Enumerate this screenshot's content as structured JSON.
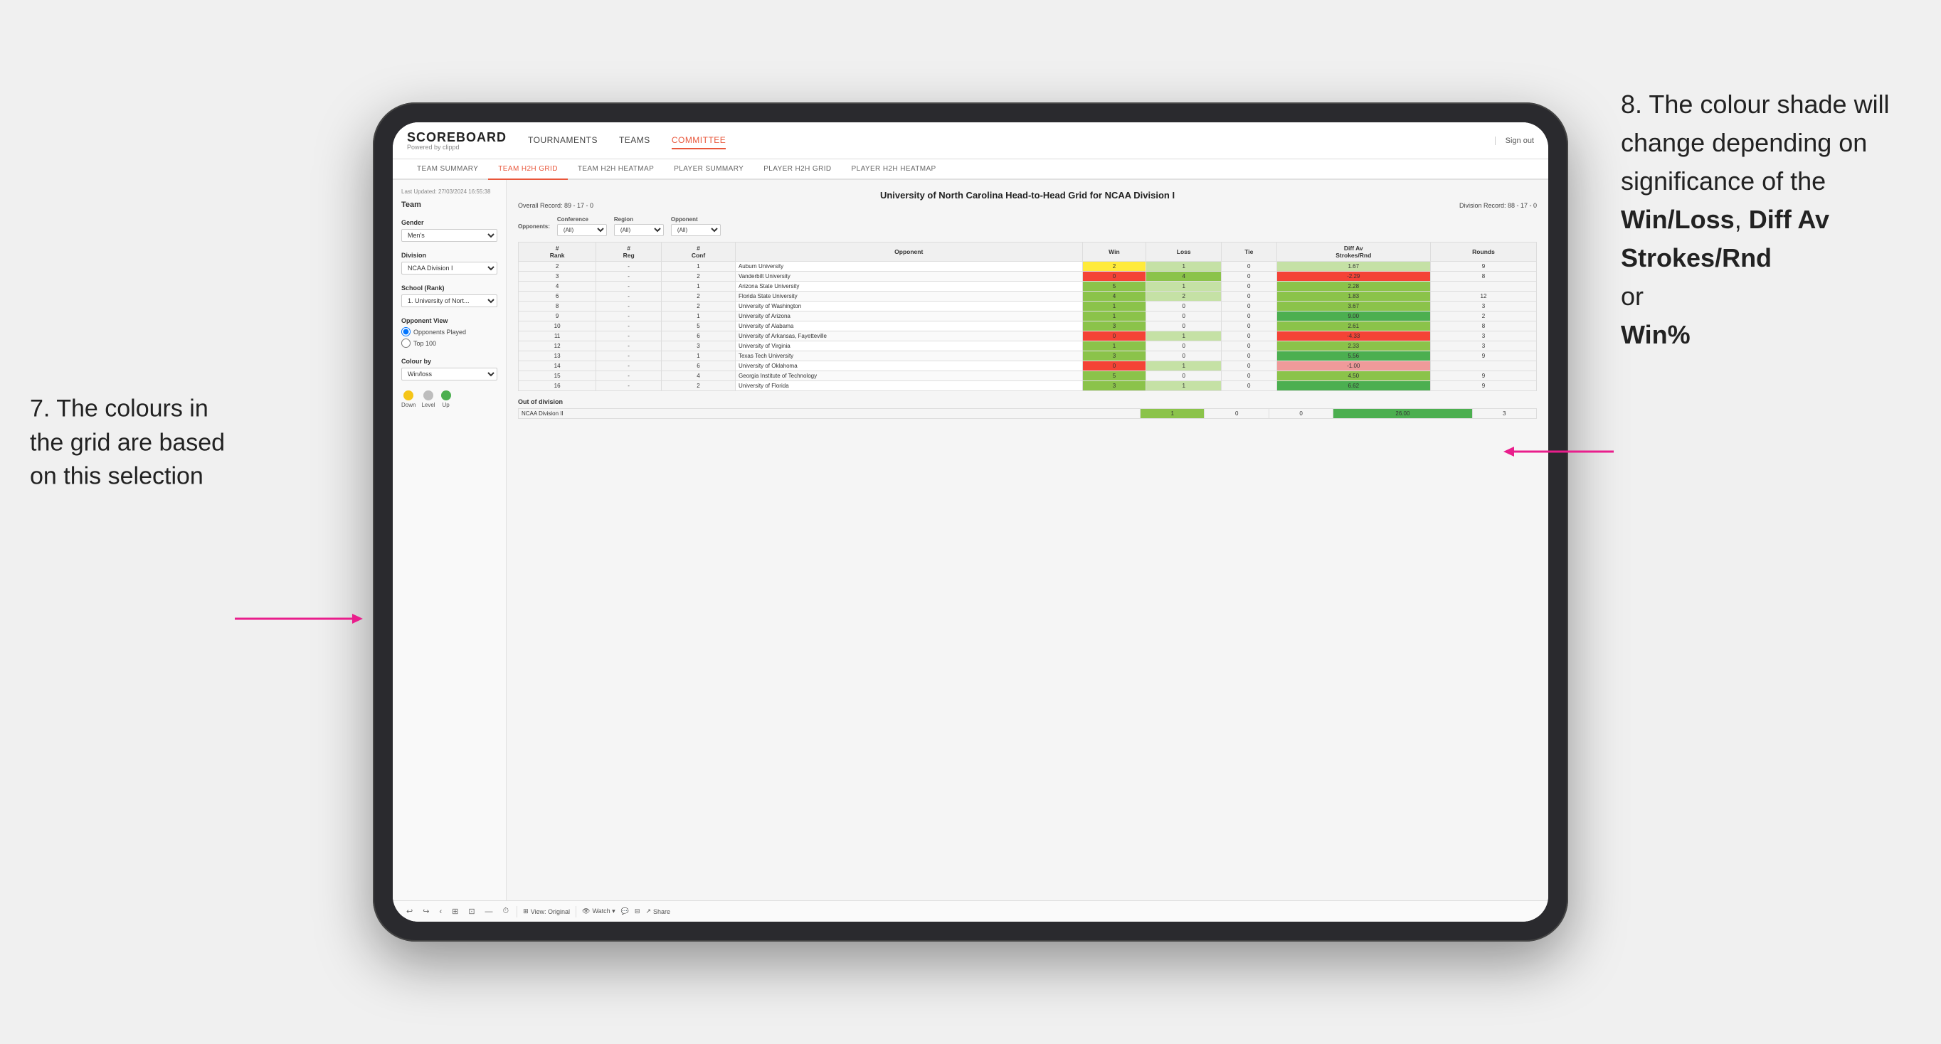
{
  "annotations": {
    "left_number": "7.",
    "left_text": "The colours in the grid are based on this selection",
    "right_number": "8.",
    "right_text": "The colour shade will change depending on significance of the",
    "right_bold1": "Win/Loss",
    "right_sep1": ", ",
    "right_bold2": "Diff Av Strokes/Rnd",
    "right_sep2": " or",
    "right_bold3": "Win%"
  },
  "app": {
    "logo": "SCOREBOARD",
    "logo_sub": "Powered by clippd",
    "sign_out": "Sign out"
  },
  "nav": {
    "items": [
      "TOURNAMENTS",
      "TEAMS",
      "COMMITTEE"
    ]
  },
  "sub_nav": {
    "items": [
      "TEAM SUMMARY",
      "TEAM H2H GRID",
      "TEAM H2H HEATMAP",
      "PLAYER SUMMARY",
      "PLAYER H2H GRID",
      "PLAYER H2H HEATMAP"
    ],
    "active": 1
  },
  "left_panel": {
    "section_team": "Team",
    "gender_label": "Gender",
    "gender_value": "Men's",
    "division_label": "Division",
    "division_value": "NCAA Division I",
    "school_label": "School (Rank)",
    "school_value": "1. University of Nort...",
    "opponent_view_label": "Opponent View",
    "radio_options": [
      "Opponents Played",
      "Top 100"
    ],
    "colour_by_label": "Colour by",
    "colour_by_value": "Win/loss",
    "legend": [
      {
        "label": "Down",
        "color": "#f44336"
      },
      {
        "label": "Level",
        "color": "#bdbdbd"
      },
      {
        "label": "Up",
        "color": "#4caf50"
      }
    ]
  },
  "grid": {
    "title": "University of North Carolina Head-to-Head Grid for NCAA Division I",
    "overall_record": "Overall Record: 89 - 17 - 0",
    "division_record": "Division Record: 88 - 17 - 0",
    "timestamp": "Last Updated: 27/03/2024 16:55:38",
    "filters": {
      "opponents_label": "Opponents:",
      "conference_label": "Conference",
      "conference_value": "(All)",
      "region_label": "Region",
      "region_value": "(All)",
      "opponent_label": "Opponent",
      "opponent_value": "(All)"
    },
    "columns": [
      "#\nRank",
      "#\nReg",
      "#\nConf",
      "Opponent",
      "Win",
      "Loss",
      "Tie",
      "Diff Av\nStrokes/Rnd",
      "Rounds"
    ],
    "rows": [
      {
        "rank": "2",
        "reg": "-",
        "conf": "1",
        "opponent": "Auburn University",
        "win": "2",
        "loss": "1",
        "tie": "0",
        "diff": "1.67",
        "rounds": "9",
        "win_class": "cell-yellow",
        "loss_class": "cell-green-light",
        "diff_class": "cell-green-light"
      },
      {
        "rank": "3",
        "reg": "-",
        "conf": "2",
        "opponent": "Vanderbilt University",
        "win": "0",
        "loss": "4",
        "tie": "0",
        "diff": "-2.29",
        "rounds": "8",
        "win_class": "cell-red",
        "loss_class": "cell-green",
        "diff_class": "cell-red"
      },
      {
        "rank": "4",
        "reg": "-",
        "conf": "1",
        "opponent": "Arizona State University",
        "win": "5",
        "loss": "1",
        "tie": "0",
        "diff": "2.28",
        "rounds": "",
        "win_class": "cell-green",
        "loss_class": "cell-green-light",
        "diff_class": "cell-green"
      },
      {
        "rank": "6",
        "reg": "-",
        "conf": "2",
        "opponent": "Florida State University",
        "win": "4",
        "loss": "2",
        "tie": "0",
        "diff": "1.83",
        "rounds": "12",
        "win_class": "cell-green",
        "loss_class": "cell-green-light",
        "diff_class": "cell-green"
      },
      {
        "rank": "8",
        "reg": "-",
        "conf": "2",
        "opponent": "University of Washington",
        "win": "1",
        "loss": "0",
        "tie": "0",
        "diff": "3.67",
        "rounds": "3",
        "win_class": "cell-green",
        "loss_class": "cell-gray",
        "diff_class": "cell-green"
      },
      {
        "rank": "9",
        "reg": "-",
        "conf": "1",
        "opponent": "University of Arizona",
        "win": "1",
        "loss": "0",
        "tie": "0",
        "diff": "9.00",
        "rounds": "2",
        "win_class": "cell-green",
        "loss_class": "cell-gray",
        "diff_class": "cell-green-dark"
      },
      {
        "rank": "10",
        "reg": "-",
        "conf": "5",
        "opponent": "University of Alabama",
        "win": "3",
        "loss": "0",
        "tie": "0",
        "diff": "2.61",
        "rounds": "8",
        "win_class": "cell-green",
        "loss_class": "cell-gray",
        "diff_class": "cell-green"
      },
      {
        "rank": "11",
        "reg": "-",
        "conf": "6",
        "opponent": "University of Arkansas, Fayetteville",
        "win": "0",
        "loss": "1",
        "tie": "0",
        "diff": "-4.33",
        "rounds": "3",
        "win_class": "cell-red",
        "loss_class": "cell-green-light",
        "diff_class": "cell-red"
      },
      {
        "rank": "12",
        "reg": "-",
        "conf": "3",
        "opponent": "University of Virginia",
        "win": "1",
        "loss": "0",
        "tie": "0",
        "diff": "2.33",
        "rounds": "3",
        "win_class": "cell-green",
        "loss_class": "cell-gray",
        "diff_class": "cell-green"
      },
      {
        "rank": "13",
        "reg": "-",
        "conf": "1",
        "opponent": "Texas Tech University",
        "win": "3",
        "loss": "0",
        "tie": "0",
        "diff": "5.56",
        "rounds": "9",
        "win_class": "cell-green",
        "loss_class": "cell-gray",
        "diff_class": "cell-green-dark"
      },
      {
        "rank": "14",
        "reg": "-",
        "conf": "6",
        "opponent": "University of Oklahoma",
        "win": "0",
        "loss": "1",
        "tie": "0",
        "diff": "-1.00",
        "rounds": "",
        "win_class": "cell-red",
        "loss_class": "cell-green-light",
        "diff_class": "cell-loss"
      },
      {
        "rank": "15",
        "reg": "-",
        "conf": "4",
        "opponent": "Georgia Institute of Technology",
        "win": "5",
        "loss": "0",
        "tie": "0",
        "diff": "4.50",
        "rounds": "9",
        "win_class": "cell-green",
        "loss_class": "cell-gray",
        "diff_class": "cell-green"
      },
      {
        "rank": "16",
        "reg": "-",
        "conf": "2",
        "opponent": "University of Florida",
        "win": "3",
        "loss": "1",
        "tie": "0",
        "diff": "6.62",
        "rounds": "9",
        "win_class": "cell-green",
        "loss_class": "cell-green-light",
        "diff_class": "cell-green-dark"
      }
    ],
    "out_of_division": {
      "label": "Out of division",
      "row": {
        "division": "NCAA Division II",
        "win": "1",
        "loss": "0",
        "tie": "0",
        "diff": "26.00",
        "rounds": "3",
        "win_class": "cell-green",
        "diff_class": "cell-green-dark"
      }
    }
  },
  "toolbar": {
    "view_label": "View: Original",
    "watch_label": "Watch ▾",
    "share_label": "Share"
  }
}
